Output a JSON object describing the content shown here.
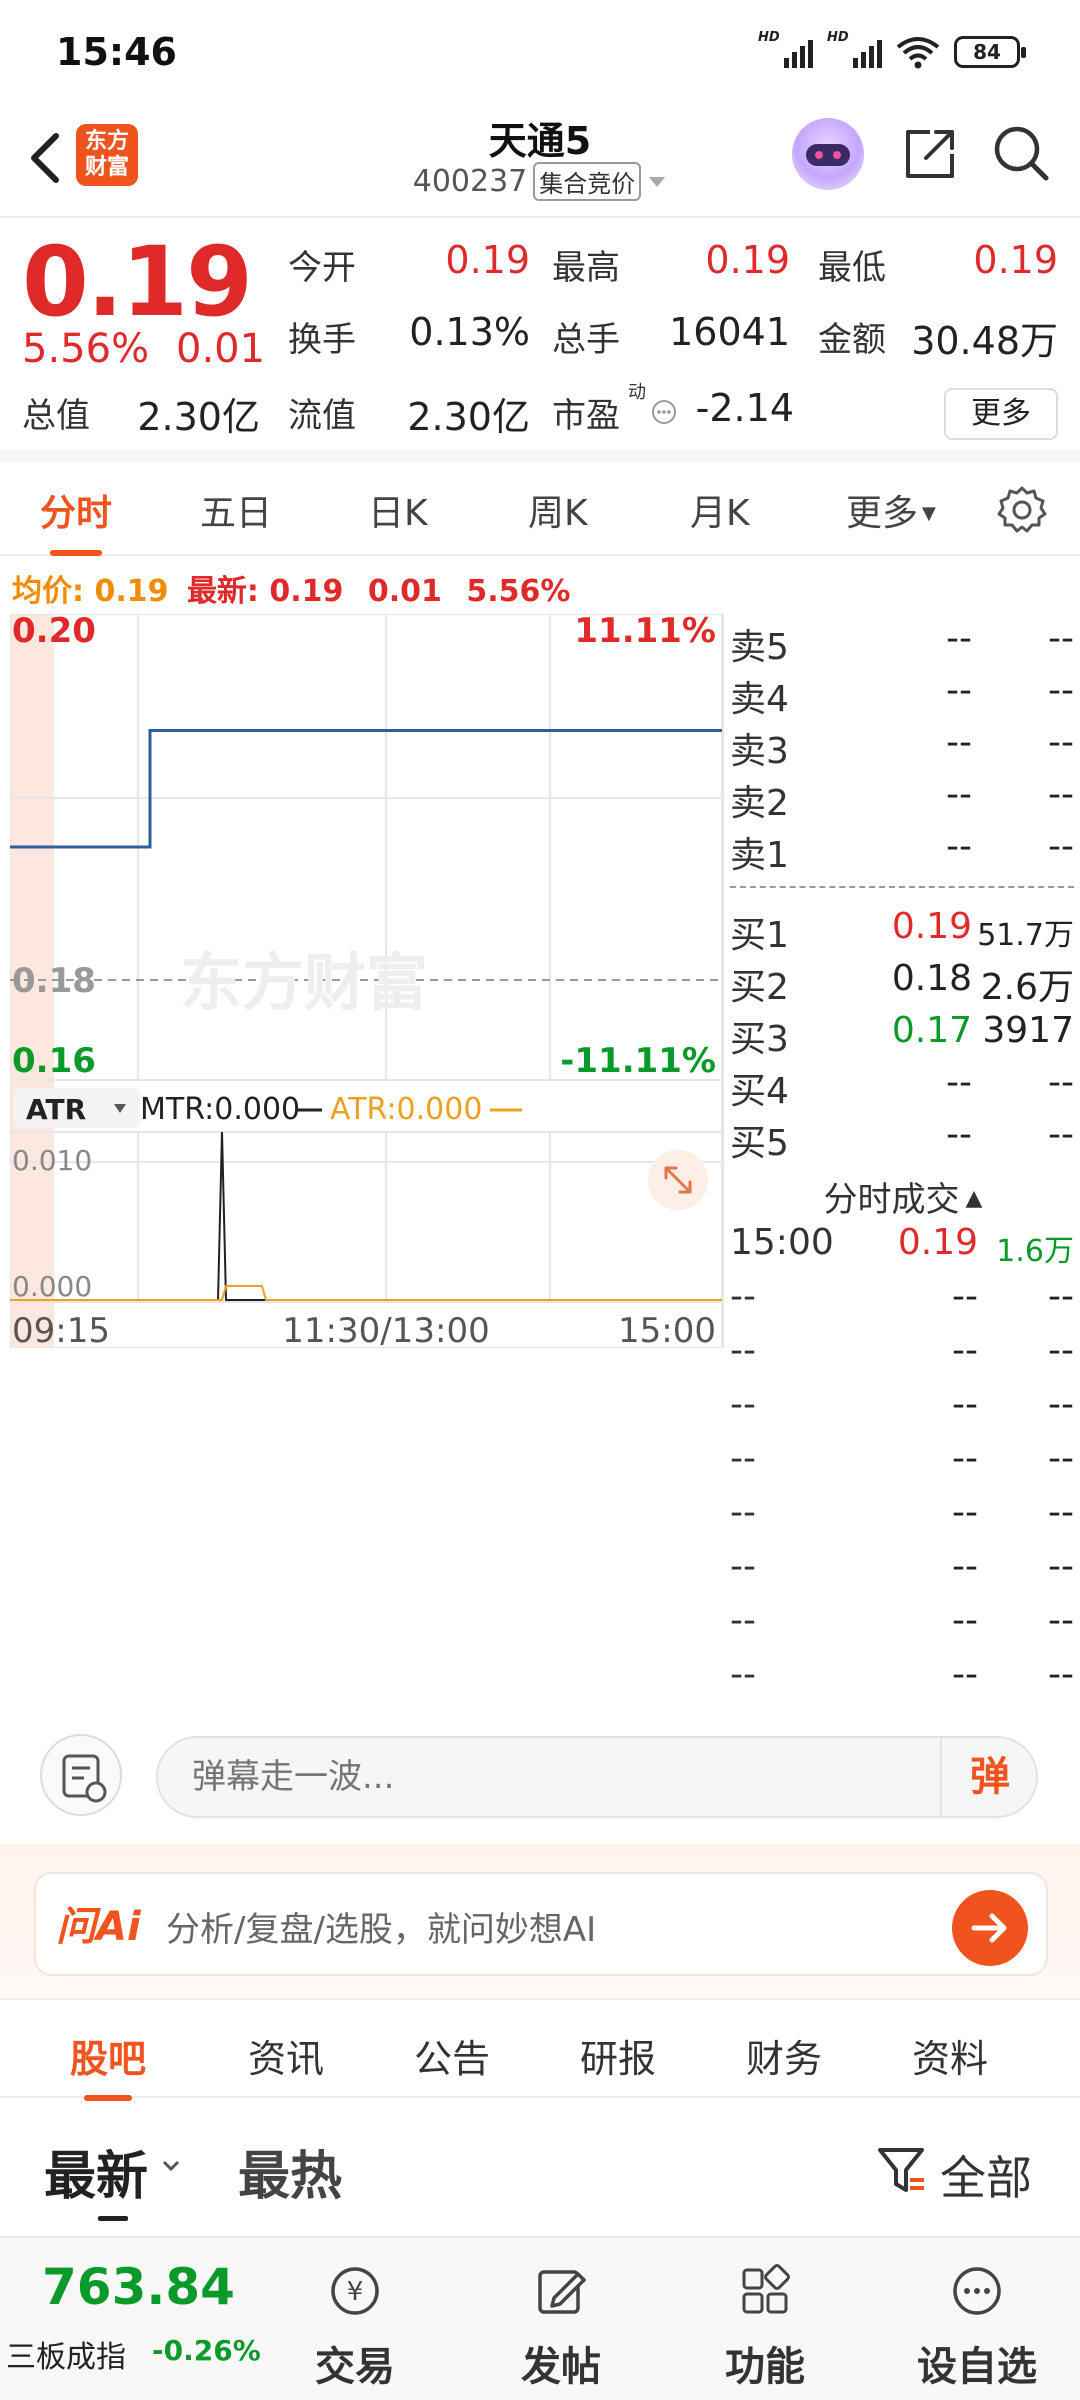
{
  "status_bar": {
    "time": "15:46",
    "battery": "84",
    "hd_label": "HD"
  },
  "header": {
    "logo_line1": "东方",
    "logo_line2": "财富",
    "stock_name": "天通5",
    "stock_code": "400237",
    "auction_badge": "集合竞价"
  },
  "quote": {
    "last_price": "0.19",
    "change_pct": "5.56%",
    "change_amt": "0.01",
    "open_label": "今开",
    "open_value": "0.19",
    "high_label": "最高",
    "high_value": "0.19",
    "low_label": "最低",
    "low_value": "0.19",
    "turnover_label": "换手",
    "turnover_value": "0.13%",
    "volume_label": "总手",
    "volume_value": "16041",
    "amount_label": "金额",
    "amount_value": "30.48万",
    "mktcap_label": "总值",
    "mktcap_value": "2.30亿",
    "float_label": "流值",
    "float_value": "2.30亿",
    "pe_label": "市盈",
    "pe_superscript": "动",
    "pe_value": "-2.14",
    "more_label": "更多"
  },
  "chart_tabs": [
    "分时",
    "五日",
    "日K",
    "周K",
    "月K",
    "更多"
  ],
  "info_line": {
    "avg_label": "均价:",
    "avg_value": "0.19",
    "latest_label": "最新:",
    "latest_value": "0.19",
    "change_amt": "0.01",
    "change_pct": "5.56%"
  },
  "chart": {
    "watermark": "东方财富",
    "y_top": "0.20",
    "y_mid": "0.18",
    "y_bottom": "0.16",
    "pct_top": "11.11%",
    "pct_bottom": "-11.11%",
    "indicator_select": "ATR",
    "mtr_label": "MTR:0.000",
    "atr_label": "ATR:0.000",
    "sub_y_top": "0.010",
    "sub_y_bottom": "0.000",
    "x_start": "09:15",
    "x_mid": "11:30/13:00",
    "x_end": "15:00",
    "colors": {
      "up": "#e02a2a",
      "down": "#0a9a2a",
      "price_line": "#2f5e99",
      "atr_line": "#f0a020",
      "accent": "#f0531e"
    }
  },
  "chart_data": {
    "type": "line",
    "title": "",
    "x": [
      "09:15",
      "11:30/13:00",
      "15:00"
    ],
    "series": [
      {
        "name": "",
        "values": [
          0.18,
          0.19,
          0.19
        ]
      }
    ],
    "prev_close": 0.18,
    "ylim": [
      0.16,
      0.2
    ],
    "grid": true
  },
  "orderbook": {
    "asks": [
      {
        "label": "卖5",
        "price": "--",
        "volume": "--"
      },
      {
        "label": "卖4",
        "price": "--",
        "volume": "--"
      },
      {
        "label": "卖3",
        "price": "--",
        "volume": "--"
      },
      {
        "label": "卖2",
        "price": "--",
        "volume": "--"
      },
      {
        "label": "卖1",
        "price": "--",
        "volume": "--"
      }
    ],
    "bids": [
      {
        "label": "买1",
        "price": "0.19",
        "volume": "51.7万"
      },
      {
        "label": "买2",
        "price": "0.18",
        "volume": "2.6万"
      },
      {
        "label": "买3",
        "price": "0.17",
        "volume": "3917"
      },
      {
        "label": "买4",
        "price": "--",
        "volume": "--"
      },
      {
        "label": "买5",
        "price": "--",
        "volume": "--"
      }
    ]
  },
  "trades": {
    "title": "分时成交",
    "rows": [
      {
        "time": "15:00",
        "price": "0.19",
        "volume": "1.6万"
      },
      {
        "time": "--",
        "price": "--",
        "volume": "--"
      },
      {
        "time": "--",
        "price": "--",
        "volume": "--"
      },
      {
        "time": "--",
        "price": "--",
        "volume": "--"
      },
      {
        "time": "--",
        "price": "--",
        "volume": "--"
      },
      {
        "time": "--",
        "price": "--",
        "volume": "--"
      },
      {
        "time": "--",
        "price": "--",
        "volume": "--"
      },
      {
        "time": "--",
        "price": "--",
        "volume": "--"
      },
      {
        "time": "--",
        "price": "--",
        "volume": "--"
      }
    ]
  },
  "danmaku": {
    "placeholder": "弹幕走一波...",
    "send_label": "弹"
  },
  "ai_bar": {
    "logo": "问Ai",
    "text": "分析/复盘/选股，就问妙想AI"
  },
  "section_tabs": [
    "股吧",
    "资讯",
    "公告",
    "研报",
    "财务",
    "资料"
  ],
  "sort": {
    "latest": "最新",
    "hot": "最热",
    "filter": "全部"
  },
  "bottom_nav": {
    "index_value": "763.84",
    "index_name": "三板成指",
    "index_change": "-0.26%",
    "items": [
      "交易",
      "发帖",
      "功能",
      "设自选"
    ]
  }
}
